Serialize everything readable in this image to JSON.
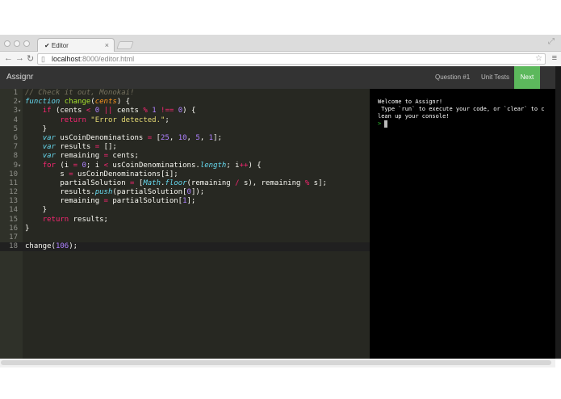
{
  "browser": {
    "tab_title": "✔ Editor",
    "tab_close": "×",
    "url_host": "localhost",
    "url_rest": ":8000/editor.html"
  },
  "navbar": {
    "brand": "Assignr",
    "links": [
      "Question #1",
      "Unit Tests"
    ],
    "next_label": "Next",
    "next_color": "#5cb85c"
  },
  "editor": {
    "theme_colors": {
      "background": "#272822",
      "comment": "#75715e",
      "keyword": "#f92672",
      "storage": "#66d9ef",
      "number": "#ae81ff",
      "string": "#e6db74",
      "function": "#a6e22e",
      "parameter": "#fd971f"
    },
    "lines": [
      {
        "num": "1",
        "fold": "",
        "html": "<span class='c'>// Check it out, Monokai!</span>"
      },
      {
        "num": "2",
        "fold": "▾",
        "html": "<span class='s'>function</span> <span class='f'>change</span>(<span class='p'>cents</span>) {"
      },
      {
        "num": "3",
        "fold": "▾",
        "html": "    <span class='k'>if</span> (cents <span class='k'>&lt;</span> <span class='n'>0</span> <span class='k'>||</span> cents <span class='k'>%</span> <span class='n'>1</span> <span class='k'>!==</span> <span class='n'>0</span>) {"
      },
      {
        "num": "4",
        "fold": "",
        "html": "        <span class='k'>return</span> <span class='st'>\"Error detected.\"</span>;"
      },
      {
        "num": "5",
        "fold": "",
        "html": "    }"
      },
      {
        "num": "6",
        "fold": "",
        "html": "    <span class='s'>var</span> usCoinDenominations <span class='k'>=</span> [<span class='n'>25</span>, <span class='n'>10</span>, <span class='n'>5</span>, <span class='n'>1</span>];"
      },
      {
        "num": "7",
        "fold": "",
        "html": "    <span class='s'>var</span> results <span class='k'>=</span> [];"
      },
      {
        "num": "8",
        "fold": "",
        "html": "    <span class='s'>var</span> remaining <span class='k'>=</span> cents;"
      },
      {
        "num": "9",
        "fold": "▾",
        "html": "    <span class='k'>for</span> (i <span class='k'>=</span> <span class='n'>0</span>; i <span class='k'>&lt;</span> usCoinDenominations.<span class='s'>length</span>; i<span class='k'>++</span>) {"
      },
      {
        "num": "10",
        "fold": "",
        "html": "        s <span class='k'>=</span> usCoinDenominations[i];"
      },
      {
        "num": "11",
        "fold": "",
        "html": "        partialSolution <span class='k'>=</span> [<span class='s'>Math</span>.<span class='s'>floor</span>(remaining <span class='k'>/</span> s), remaining <span class='k'>%</span> s];"
      },
      {
        "num": "12",
        "fold": "",
        "html": "        results.<span class='s'>push</span>(partialSolution[<span class='n'>0</span>]);"
      },
      {
        "num": "13",
        "fold": "",
        "html": "        remaining <span class='k'>=</span> partialSolution[<span class='n'>1</span>];"
      },
      {
        "num": "14",
        "fold": "",
        "html": "    }"
      },
      {
        "num": "15",
        "fold": "",
        "html": "    <span class='k'>return</span> results;"
      },
      {
        "num": "16",
        "fold": "",
        "html": "}"
      },
      {
        "num": "17",
        "fold": "",
        "html": ""
      },
      {
        "num": "18",
        "fold": "",
        "html": "change(<span class='n'>106</span>);",
        "active": true
      }
    ]
  },
  "console": {
    "lines": [
      "Welcome to Assignr!",
      " Type `run` to execute your code, or `clear` to c",
      "lean up your console!"
    ],
    "prompt": ">"
  }
}
